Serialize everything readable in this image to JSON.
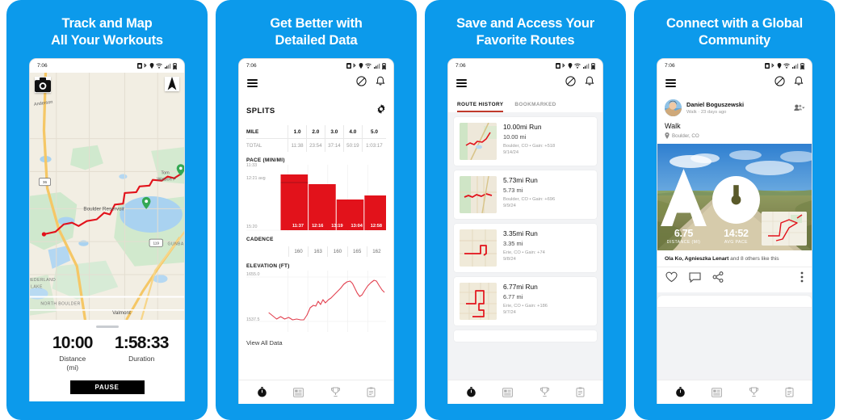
{
  "theme": {
    "brand_blue": "#0c9aeb",
    "accent_red": "#e2121b",
    "dark": "#111111"
  },
  "panels": [
    {
      "title": "Track and Map\nAll Your Workouts",
      "title_line1": "Track and Map",
      "title_line2": "All Your Workouts",
      "statusbar": {
        "time": "7:06"
      },
      "map": {
        "camera_icon": "camera-icon",
        "compass_icon": "compass-icon",
        "labels": [
          "Boulder Reservoir",
          "Tom Watson P",
          "NEDERLAND LAKE",
          "NORTH BOULDER",
          "Valmont",
          "GUNBA"
        ],
        "route_shields": [
          "36",
          "119"
        ]
      },
      "stats": [
        {
          "value": "10:00",
          "label": "Distance\n(mi)",
          "label_line1": "Distance",
          "label_line2": "(mi)"
        },
        {
          "value": "1:58:33",
          "label": "Duration",
          "label_line1": "Duration",
          "label_line2": ""
        }
      ],
      "pause_label": "PAUSE"
    },
    {
      "title_line1": "Get Better with",
      "title_line2": "Detailed Data",
      "statusbar": {
        "time": "7:06"
      },
      "splits": {
        "heading": "SPLITS",
        "settings_icon": "gear-icon",
        "header_row": [
          "MILE",
          "1.0",
          "2.0",
          "3.0",
          "4.0",
          "5.0"
        ],
        "total_row": [
          "TOTAL",
          "11:38",
          "23:54",
          "37:14",
          "50:19",
          "1:03:17"
        ],
        "pace_label": "PACE (MIN/MI)",
        "pace_axis_top": "11:33",
        "pace_axis_avg": "12:21 avg",
        "pace_axis_bottom": "15:20",
        "pace_values": [
          "11:37",
          "12:16",
          "13:19",
          "13:04",
          "12:58"
        ],
        "cadence_label": "CADENCE",
        "cadence_values": [
          "160",
          "163",
          "160",
          "165",
          "162"
        ],
        "elevation_label": "ELEVATION (FT)",
        "elevation_max": "1655.0",
        "elevation_min": "1537.5",
        "view_all": "View All Data"
      }
    },
    {
      "title_line1": "Save and Access Your",
      "title_line2": "Favorite Routes",
      "statusbar": {
        "time": "7:06"
      },
      "tabs": [
        {
          "label": "ROUTE HISTORY",
          "active": true
        },
        {
          "label": "BOOKMARKED",
          "active": false
        }
      ],
      "routes": [
        {
          "title": "10.00mi Run",
          "distance": "10.00 mi",
          "meta": "Boulder, CO • Gain: +518",
          "date": "9/14/24"
        },
        {
          "title": "5.73mi Run",
          "distance": "5.73 mi",
          "meta": "Boulder, CO • Gain: +696",
          "date": "9/9/24"
        },
        {
          "title": "3.35mi Run",
          "distance": "3.35 mi",
          "meta": "Erie, CO • Gain: +74",
          "date": "9/8/24"
        },
        {
          "title": "6.77mi Run",
          "distance": "6.77 mi",
          "meta": "Erie, CO • Gain: +186",
          "date": "9/7/24"
        }
      ]
    },
    {
      "title_line1": "Connect with a Global",
      "title_line2": "Community",
      "statusbar": {
        "time": "7:06"
      },
      "post": {
        "author": "Daniel Boguszewski",
        "subtitle": "Walk · 23 days ago",
        "activity": "Walk",
        "location": "Boulder, CO",
        "privacy_icon": "people-icon",
        "stats": [
          {
            "icon": "distance-icon",
            "value": "6.75",
            "label": "DISTANCE (MI)"
          },
          {
            "icon": "pace-icon",
            "value": "14:52",
            "label": "AVG PACE"
          }
        ],
        "likes_names": "Ola Ko, Agnieszka Lenart",
        "likes_rest": " and 8 others like this",
        "actions": [
          "heart-icon",
          "comment-icon",
          "share-icon",
          "more-icon"
        ]
      }
    }
  ],
  "bottom_nav": [
    {
      "icon": "stopwatch-icon",
      "active": true
    },
    {
      "icon": "feed-icon",
      "active": false
    },
    {
      "icon": "trophy-icon",
      "active": false
    },
    {
      "icon": "clipboard-icon",
      "active": false
    }
  ],
  "chart_data": [
    {
      "type": "bar",
      "title": "PACE (MIN/MI)",
      "categories": [
        "1.0",
        "2.0",
        "3.0",
        "4.0",
        "5.0"
      ],
      "values": [
        697,
        736,
        799,
        784,
        778
      ],
      "value_labels": [
        "11:37",
        "12:16",
        "13:19",
        "13:04",
        "12:58"
      ],
      "ylabel": "pace (min/mi)",
      "ylim": [
        "11:33",
        "15:20"
      ],
      "average": "12:21 avg",
      "grid": true,
      "legend": "none"
    },
    {
      "type": "line",
      "title": "ELEVATION (FT)",
      "x": [
        0,
        1,
        2,
        3,
        4,
        5
      ],
      "values": [
        1560,
        1552,
        1558,
        1600,
        1625,
        1650
      ],
      "ylabel": "elevation (ft)",
      "ylim": [
        1537.5,
        1655.0
      ],
      "grid": true,
      "legend": "none"
    },
    {
      "type": "table",
      "title": "SPLITS",
      "columns": [
        "MILE",
        "1.0",
        "2.0",
        "3.0",
        "4.0",
        "5.0"
      ],
      "rows": [
        [
          "TOTAL",
          "11:38",
          "23:54",
          "37:14",
          "50:19",
          "1:03:17"
        ],
        [
          "CADENCE",
          "160",
          "163",
          "160",
          "165",
          "162"
        ]
      ]
    }
  ]
}
